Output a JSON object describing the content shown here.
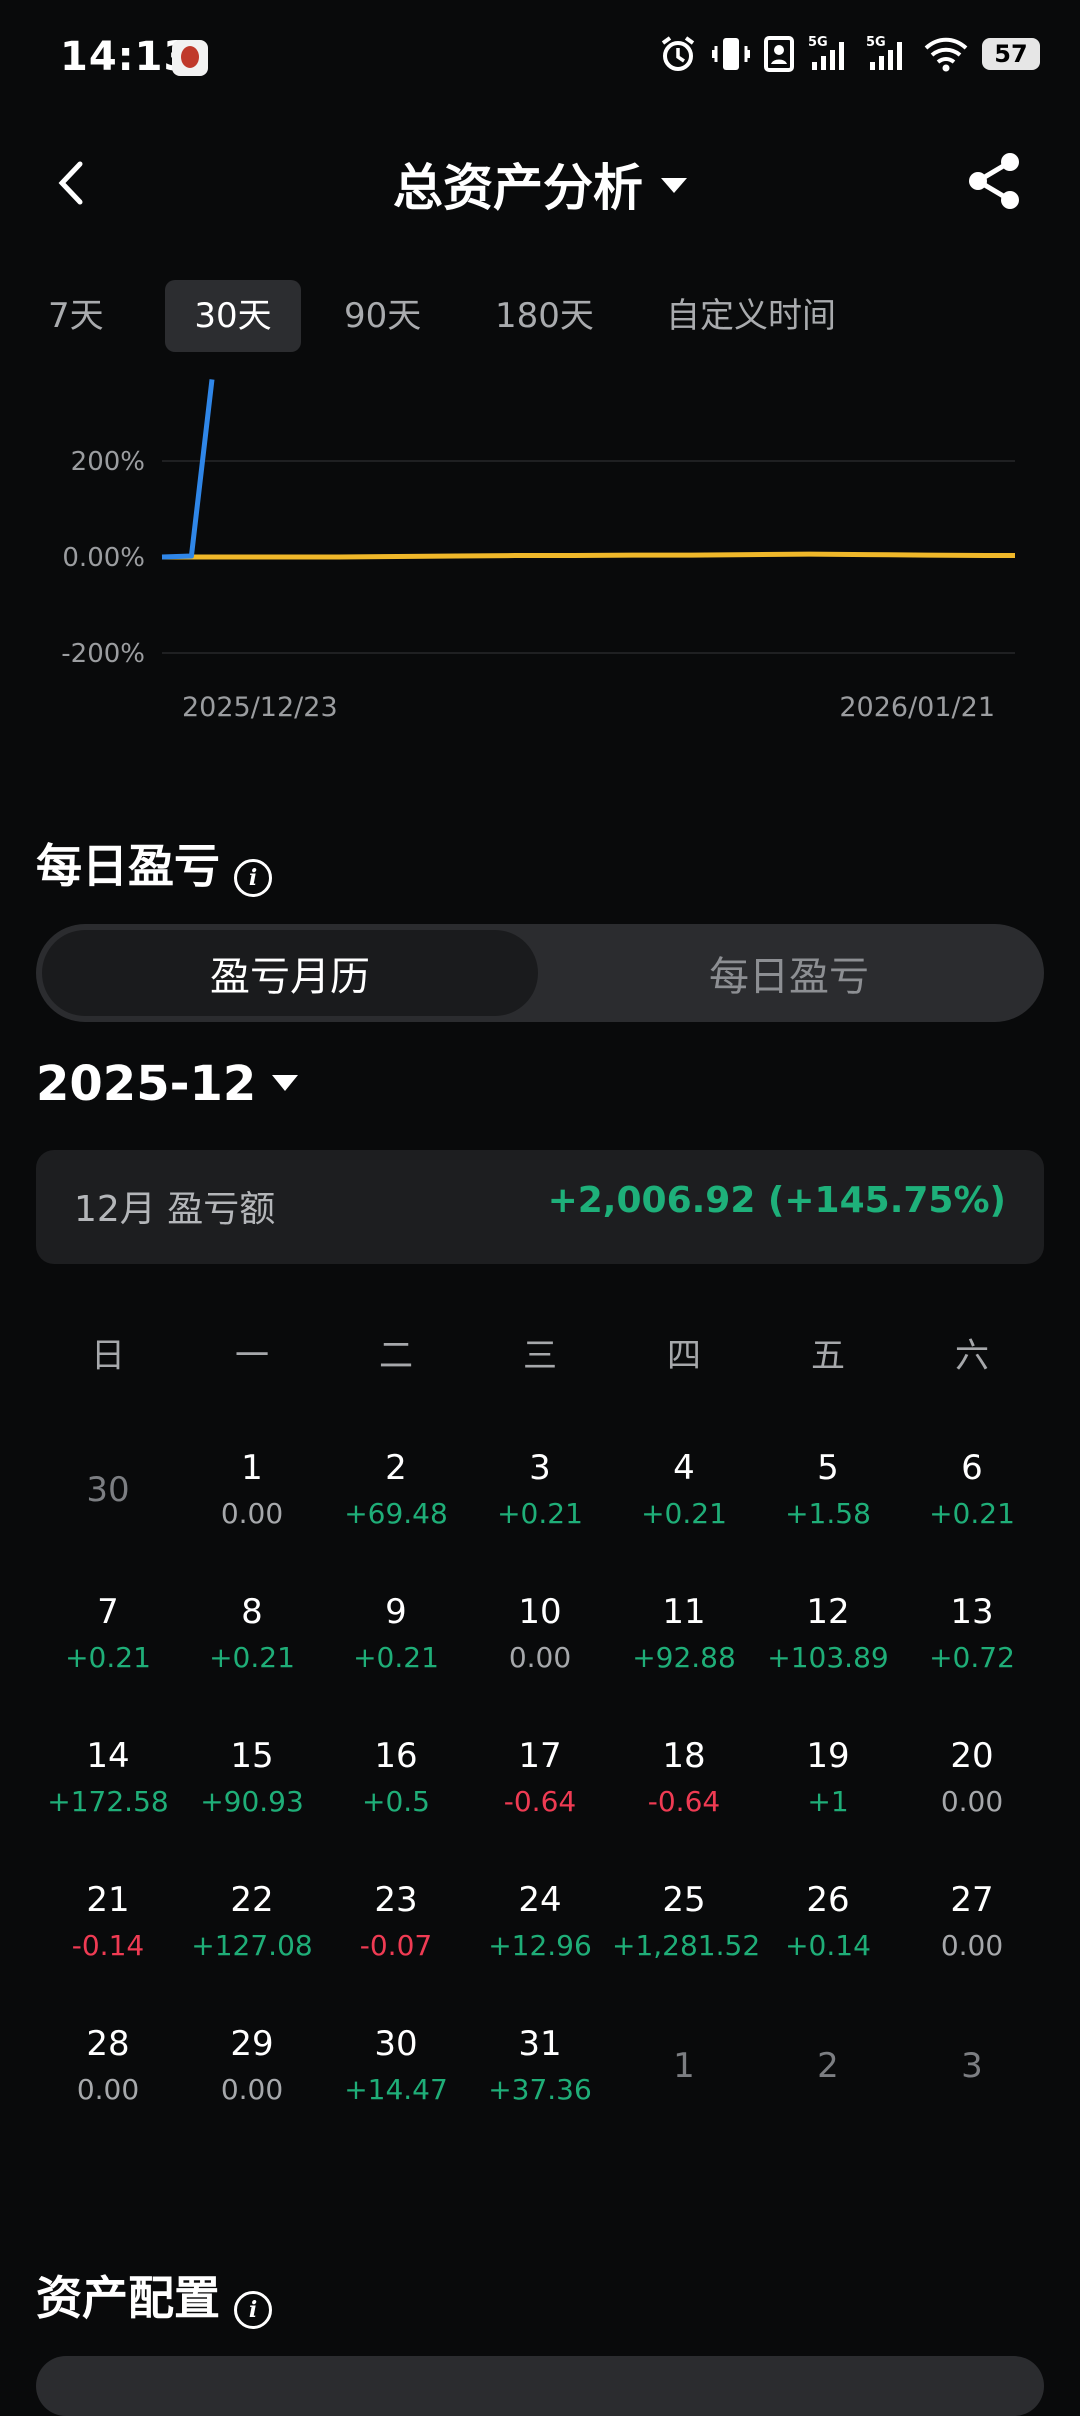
{
  "status_bar": {
    "time": "14:13",
    "battery": "57",
    "signal1": "5G",
    "signal2": "5G"
  },
  "header": {
    "title": "总资产分析"
  },
  "period_tabs": [
    {
      "label": "7天",
      "active": false
    },
    {
      "label": "30天",
      "active": true
    },
    {
      "label": "90天",
      "active": false
    },
    {
      "label": "180天",
      "active": false
    },
    {
      "label": "自定义时间",
      "active": false
    }
  ],
  "chart_data": {
    "type": "line",
    "y_ticks": [
      "200%",
      "0.00%",
      "-200%"
    ],
    "ylim": [
      -200,
      200
    ],
    "x_ticks": [
      "2025/12/23",
      "2026/01/21"
    ],
    "series": [
      {
        "color": "#2f86e8",
        "x": [
          0,
          1,
          1.7
        ],
        "values": [
          0,
          2,
          370
        ]
      },
      {
        "color": "#f0b82a",
        "x": [
          0,
          2,
          4,
          6,
          8,
          10,
          12,
          14,
          16,
          18,
          20,
          22,
          24,
          26,
          28,
          29
        ],
        "values": [
          0,
          0,
          0,
          0,
          1,
          2,
          3,
          3,
          4,
          4,
          5,
          6,
          5,
          4,
          3,
          3
        ]
      }
    ]
  },
  "daily_pnl": {
    "title": "每日盈亏",
    "segments": {
      "left": "盈亏月历",
      "right": "每日盈亏"
    },
    "month": "2025-12",
    "summary": {
      "label": "12月 盈亏额",
      "value": "+2,006.92 (+145.75%)"
    },
    "weekdays": [
      "日",
      "一",
      "二",
      "三",
      "四",
      "五",
      "六"
    ],
    "rows": [
      [
        {
          "d": "30",
          "v": "",
          "t": "dim"
        },
        {
          "d": "1",
          "v": "0.00",
          "t": "zero"
        },
        {
          "d": "2",
          "v": "+69.48",
          "t": "pos"
        },
        {
          "d": "3",
          "v": "+0.21",
          "t": "pos"
        },
        {
          "d": "4",
          "v": "+0.21",
          "t": "pos"
        },
        {
          "d": "5",
          "v": "+1.58",
          "t": "pos"
        },
        {
          "d": "6",
          "v": "+0.21",
          "t": "pos"
        }
      ],
      [
        {
          "d": "7",
          "v": "+0.21",
          "t": "pos"
        },
        {
          "d": "8",
          "v": "+0.21",
          "t": "pos"
        },
        {
          "d": "9",
          "v": "+0.21",
          "t": "pos"
        },
        {
          "d": "10",
          "v": "0.00",
          "t": "zero"
        },
        {
          "d": "11",
          "v": "+92.88",
          "t": "pos"
        },
        {
          "d": "12",
          "v": "+103.89",
          "t": "pos"
        },
        {
          "d": "13",
          "v": "+0.72",
          "t": "pos"
        }
      ],
      [
        {
          "d": "14",
          "v": "+172.58",
          "t": "pos"
        },
        {
          "d": "15",
          "v": "+90.93",
          "t": "pos"
        },
        {
          "d": "16",
          "v": "+0.5",
          "t": "pos"
        },
        {
          "d": "17",
          "v": "-0.64",
          "t": "neg"
        },
        {
          "d": "18",
          "v": "-0.64",
          "t": "neg"
        },
        {
          "d": "19",
          "v": "+1",
          "t": "pos"
        },
        {
          "d": "20",
          "v": "0.00",
          "t": "zero"
        }
      ],
      [
        {
          "d": "21",
          "v": "-0.14",
          "t": "neg"
        },
        {
          "d": "22",
          "v": "+127.08",
          "t": "pos"
        },
        {
          "d": "23",
          "v": "-0.07",
          "t": "neg"
        },
        {
          "d": "24",
          "v": "+12.96",
          "t": "pos"
        },
        {
          "d": "25",
          "v": "+1,281.52",
          "t": "pos"
        },
        {
          "d": "26",
          "v": "+0.14",
          "t": "pos"
        },
        {
          "d": "27",
          "v": "0.00",
          "t": "zero"
        }
      ],
      [
        {
          "d": "28",
          "v": "0.00",
          "t": "zero"
        },
        {
          "d": "29",
          "v": "0.00",
          "t": "zero"
        },
        {
          "d": "30",
          "v": "+14.47",
          "t": "pos"
        },
        {
          "d": "31",
          "v": "+37.36",
          "t": "pos"
        },
        {
          "d": "1",
          "v": "",
          "t": "dim"
        },
        {
          "d": "2",
          "v": "",
          "t": "dim"
        },
        {
          "d": "3",
          "v": "",
          "t": "dim"
        }
      ]
    ]
  },
  "asset_alloc": {
    "title": "资产配置"
  }
}
